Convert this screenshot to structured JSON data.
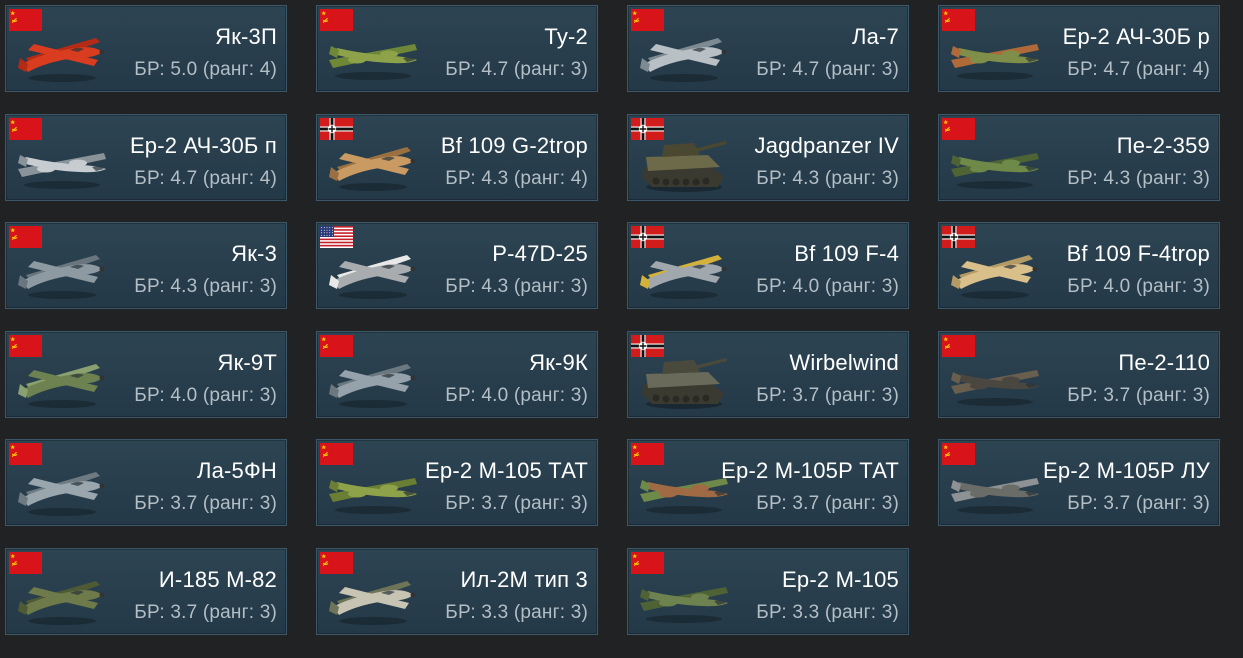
{
  "vehicles": [
    {
      "name": "Як-3П",
      "br": "БР: 5.0 (ранг: 4)",
      "nation": "ussr",
      "kind": "plane",
      "colors": [
        "#d93c1e",
        "#b52a14"
      ]
    },
    {
      "name": "Ту-2",
      "br": "БР: 4.7 (ранг: 3)",
      "nation": "ussr",
      "kind": "bomber",
      "colors": [
        "#8ea24a",
        "#6f8838"
      ]
    },
    {
      "name": "Ла-7",
      "br": "БР: 4.7 (ранг: 3)",
      "nation": "ussr",
      "kind": "plane",
      "colors": [
        "#b8c0c6",
        "#7d8a92"
      ]
    },
    {
      "name": "Ер-2 АЧ-30Б р",
      "br": "БР: 4.7 (ранг: 4)",
      "nation": "ussr",
      "kind": "bomber",
      "colors": [
        "#7f8f4a",
        "#b06a3a"
      ]
    },
    {
      "name": "Ер-2 АЧ-30Б п",
      "br": "БР: 4.7 (ранг: 4)",
      "nation": "ussr",
      "kind": "bomber",
      "colors": [
        "#c7ccd0",
        "#8a939a"
      ]
    },
    {
      "name": "Bf 109 G-2trop",
      "br": "БР: 4.3 (ранг: 4)",
      "nation": "germany",
      "kind": "plane",
      "colors": [
        "#c99a62",
        "#9a7040"
      ]
    },
    {
      "name": "Jagdpanzer IV",
      "br": "БР: 4.3 (ранг: 3)",
      "nation": "germany",
      "kind": "tank",
      "colors": [
        "#6d6a4a",
        "#4b4832"
      ]
    },
    {
      "name": "Пе-2-359",
      "br": "БР: 4.3 (ранг: 3)",
      "nation": "ussr",
      "kind": "bomber",
      "colors": [
        "#6f8a48",
        "#4f6434"
      ]
    },
    {
      "name": "Як-3",
      "br": "БР: 4.3 (ранг: 3)",
      "nation": "ussr",
      "kind": "plane",
      "colors": [
        "#8e9aa2",
        "#6a767e"
      ]
    },
    {
      "name": "P-47D-25",
      "br": "БР: 4.3 (ранг: 3)",
      "nation": "usa",
      "kind": "plane",
      "colors": [
        "#a8acae",
        "#e8e8e8"
      ]
    },
    {
      "name": "Bf 109 F-4",
      "br": "БР: 4.0 (ранг: 3)",
      "nation": "germany",
      "kind": "plane",
      "colors": [
        "#a0a8ae",
        "#d4b23a"
      ]
    },
    {
      "name": "Bf 109 F-4trop",
      "br": "БР: 4.0 (ранг: 3)",
      "nation": "germany",
      "kind": "plane",
      "colors": [
        "#d9c08a",
        "#b49a64"
      ]
    },
    {
      "name": "Як-9Т",
      "br": "БР: 4.0 (ранг: 3)",
      "nation": "ussr",
      "kind": "plane",
      "colors": [
        "#6d8250",
        "#8aa070"
      ]
    },
    {
      "name": "Як-9К",
      "br": "БР: 4.0 (ранг: 3)",
      "nation": "ussr",
      "kind": "plane",
      "colors": [
        "#96a2ab",
        "#6c7880"
      ]
    },
    {
      "name": "Wirbelwind",
      "br": "БР: 3.7 (ранг: 3)",
      "nation": "germany",
      "kind": "tank",
      "colors": [
        "#6a6a5a",
        "#4a4a3c"
      ]
    },
    {
      "name": "Пе-2-110",
      "br": "БР: 3.7 (ранг: 3)",
      "nation": "ussr",
      "kind": "bomber",
      "colors": [
        "#4a4640",
        "#6a5e4e"
      ]
    },
    {
      "name": "Ла-5ФН",
      "br": "БР: 3.7 (ранг: 3)",
      "nation": "ussr",
      "kind": "plane",
      "colors": [
        "#9aa6ae",
        "#6e7a82"
      ]
    },
    {
      "name": "Ер-2 М-105 ТАТ",
      "br": "БР: 3.7 (ранг: 3)",
      "nation": "ussr",
      "kind": "bomber",
      "colors": [
        "#8ea24a",
        "#6a7e34"
      ]
    },
    {
      "name": "Ер-2 М-105Р ТАТ",
      "br": "БР: 3.7 (ранг: 3)",
      "nation": "ussr",
      "kind": "bomber",
      "colors": [
        "#a06a44",
        "#6f8a48"
      ]
    },
    {
      "name": "Ер-2 М-105Р ЛУ",
      "br": "БР: 3.7 (ранг: 3)",
      "nation": "ussr",
      "kind": "bomber",
      "colors": [
        "#6a6c68",
        "#8e9294"
      ]
    },
    {
      "name": "И-185 М-82",
      "br": "БР: 3.7 (ранг: 3)",
      "nation": "ussr",
      "kind": "plane",
      "colors": [
        "#6e7a4a",
        "#4e5a34"
      ]
    },
    {
      "name": "Ил-2М тип 3",
      "br": "БР: 3.3 (ранг: 3)",
      "nation": "ussr",
      "kind": "plane",
      "colors": [
        "#c8c4b4",
        "#6e7458"
      ]
    },
    {
      "name": "Ер-2 М-105",
      "br": "БР: 3.3 (ранг: 3)",
      "nation": "ussr",
      "kind": "bomber",
      "colors": [
        "#6e8250",
        "#4e6236"
      ]
    }
  ]
}
